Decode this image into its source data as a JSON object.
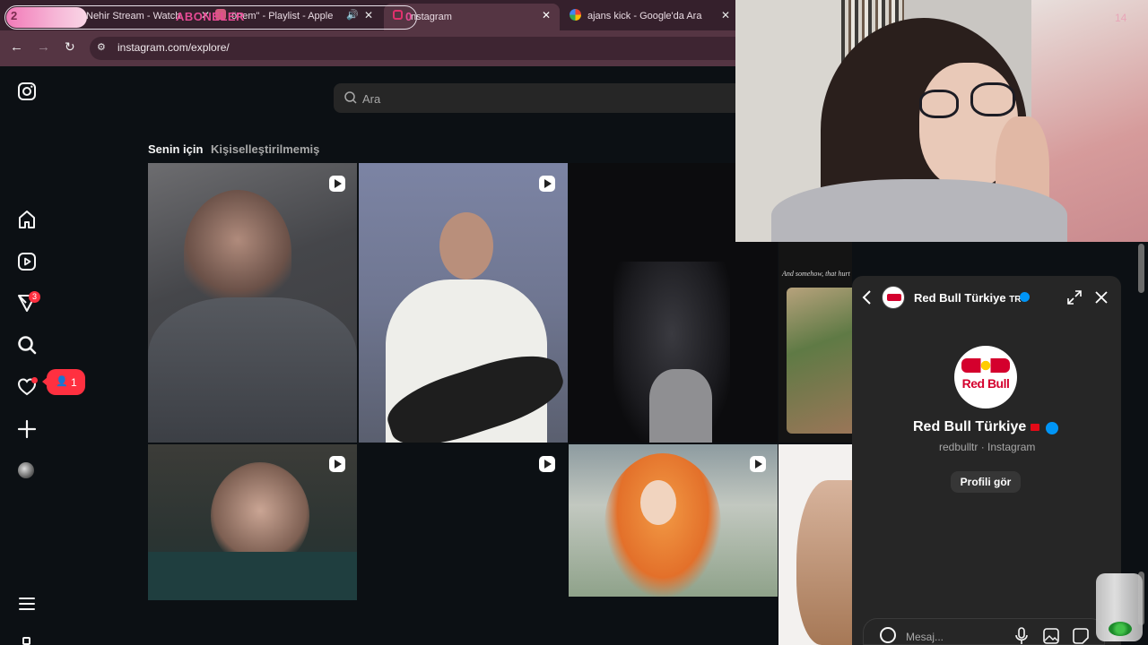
{
  "browser": {
    "tabs": [
      {
        "label": "Nehir Stream - Watch"
      },
      {
        "label": "önem\" - Playlist - Apple"
      },
      {
        "label": "nstagram"
      },
      {
        "label": "ajans kick - Google'da Ara"
      }
    ],
    "url": "instagram.com/explore/"
  },
  "overlay": {
    "count": "2",
    "label": "ABONELER",
    "value": "0"
  },
  "sidebar": {
    "items": [
      {
        "name": "instagram-logo"
      },
      {
        "name": "home-icon"
      },
      {
        "name": "reels-icon"
      },
      {
        "name": "explore-icon",
        "badge": "3"
      },
      {
        "name": "search-icon"
      },
      {
        "name": "heart-icon"
      },
      {
        "name": "create-icon"
      },
      {
        "name": "profile-avatar"
      },
      {
        "name": "menu-icon"
      }
    ],
    "notification_pill": {
      "count": "1"
    }
  },
  "search": {
    "placeholder": "Ara"
  },
  "explore_tabs": {
    "for_you": "Senin için",
    "not_personalized": "Kişiselleştirilmemiş"
  },
  "tile_caption": "And somehow, that hurt the most",
  "webcam": {
    "counter": "14"
  },
  "chat": {
    "header_name": "Red Bull Türkiye",
    "header_flag": "TR",
    "logo_text": "Red Bull",
    "profile_name": "Red Bull Türkiye",
    "profile_sub": "redbulltr · Instagram",
    "profile_button": "Profili gör",
    "message_placeholder": "Mesaj..."
  },
  "colors": {
    "brand_red": "#d4002d",
    "verified": "#0095f6",
    "badge": "#ff3040",
    "overlay_pink": "#e64b95"
  }
}
